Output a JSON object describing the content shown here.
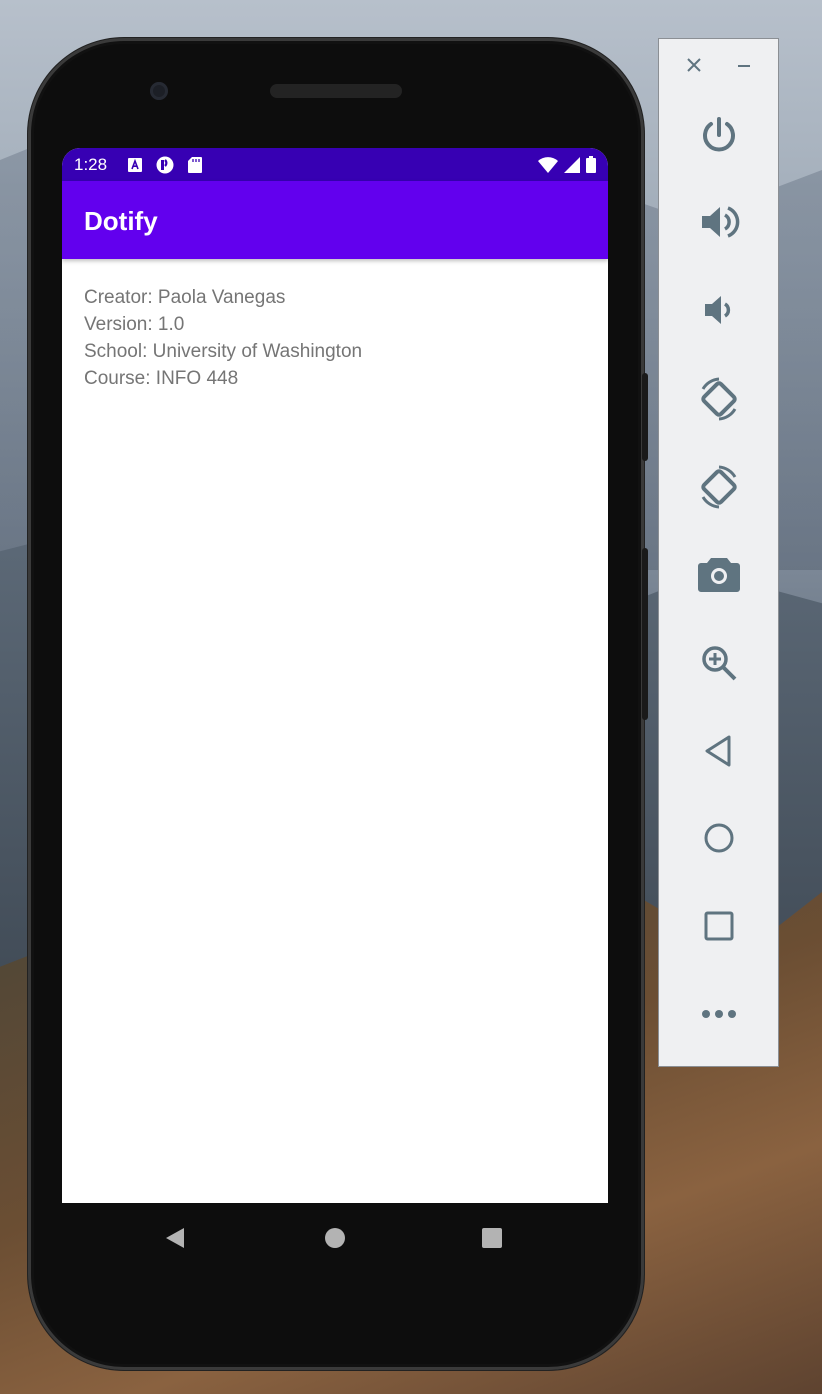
{
  "status_bar": {
    "time": "1:28",
    "left_icons": [
      "a-notification-icon",
      "location-notification-icon",
      "sd-card-icon"
    ],
    "right_icons": [
      "wifi-icon",
      "signal-icon",
      "battery-icon"
    ],
    "color": "#3700b3"
  },
  "app_bar": {
    "title": "Dotify",
    "color": "#6200ee"
  },
  "content": {
    "lines": [
      "Creator: Paola Vanegas",
      "Version: 1.0",
      "School: University of Washington",
      "Course: INFO 448"
    ]
  },
  "nav_bar": {
    "buttons": [
      "back-icon",
      "home-icon",
      "recents-icon"
    ]
  },
  "emulator_panel": {
    "window_controls": [
      "close-icon",
      "minimize-icon"
    ],
    "tools": [
      "power-icon",
      "volume-up-icon",
      "volume-down-icon",
      "rotate-left-icon",
      "rotate-right-icon",
      "screenshot-camera-icon",
      "zoom-icon",
      "back-icon",
      "home-icon",
      "overview-icon",
      "more-icon"
    ],
    "icon_color": "#5f7480"
  }
}
